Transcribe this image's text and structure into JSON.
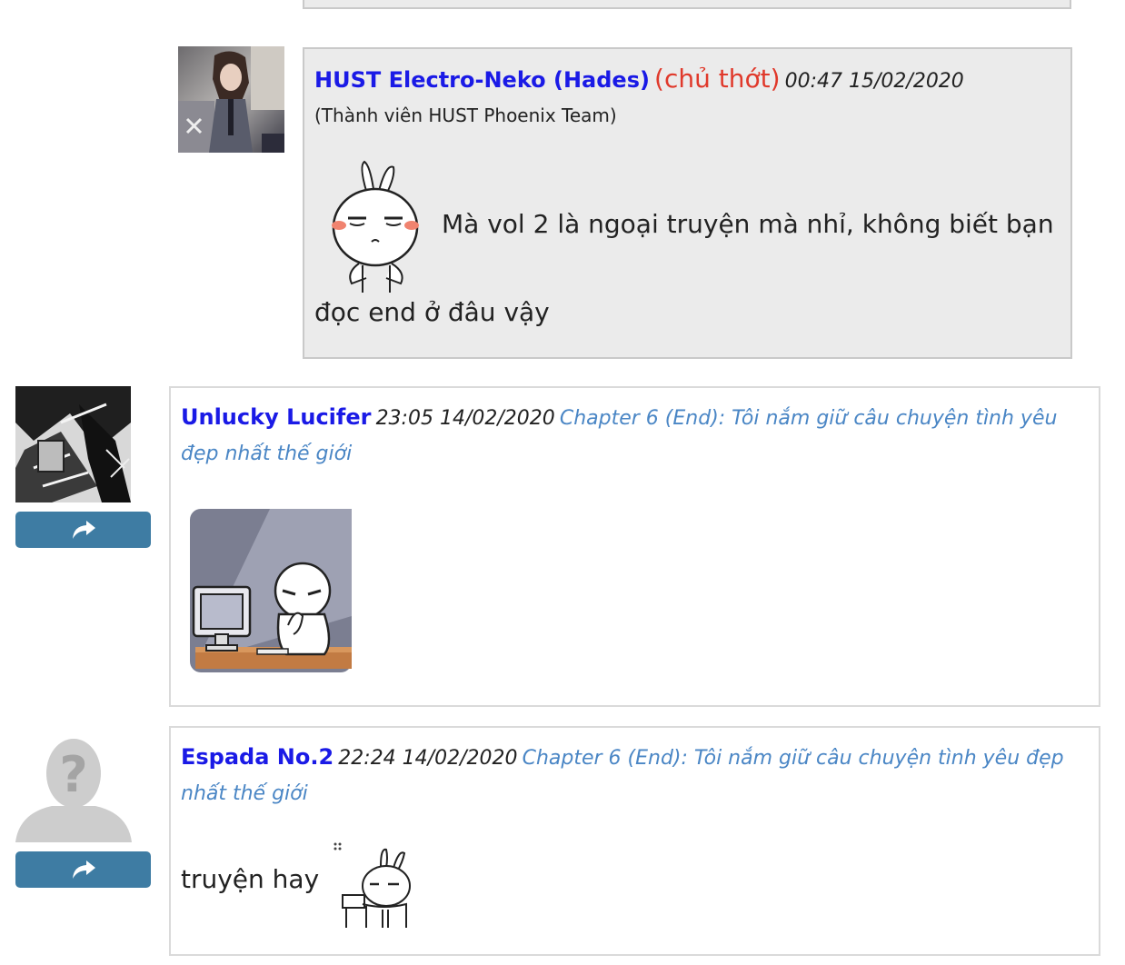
{
  "comments": [
    {
      "username": "HUST Electro-Neko (Hades)",
      "owner_tag": "(chủ thớt)",
      "time": "00:47 15/02/2020",
      "member_note": "(Thành viên HUST Phoenix Team)",
      "text_line1": "Mà vol 2 là ngoại truyện mà nhỉ, không biết bạn",
      "text_line2": "đọc end ở đâu vậy",
      "avatar_icon": "anime-character-avatar",
      "sticker_icon": "bunny-sulking-sticker"
    },
    {
      "username": "Unlucky Lucifer",
      "time": "23:05 14/02/2020",
      "chapter": "Chapter 6 (End): Tôi nắm giữ câu chuyện tình yêu",
      "chapter_line2": "đẹp nhất thế giới",
      "avatar_icon": "manga-art-avatar",
      "share_icon": "share-arrow-icon",
      "sticker_icon": "computer-thinking-sticker"
    },
    {
      "username": "Espada No.2",
      "time": "22:24 14/02/2020",
      "chapter": "Chapter 6 (End): Tôi nắm giữ câu chuyện tình yêu đẹp",
      "chapter_line2": "nhất thế giới",
      "text": "truyện hay",
      "avatar_icon": "default-user-avatar",
      "share_icon": "share-arrow-icon",
      "sticker_icon": "bunny-sleepy-sticker"
    }
  ],
  "colors": {
    "username": "#1a1ae6",
    "owner_tag": "#e0392b",
    "chapter_link": "#4a86c5",
    "share_button": "#3e7ca3",
    "reply_bg": "#ebebeb"
  }
}
